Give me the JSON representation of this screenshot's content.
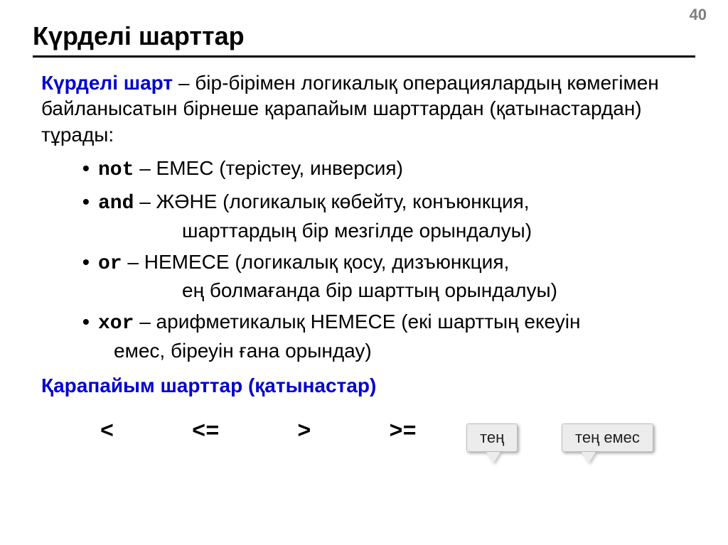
{
  "page_number": "40",
  "title": "Күрделі шарттар",
  "definition": {
    "term": "Күрделі шарт",
    "rest": " – бір-бірімен логикалық операциялардың көмегімен байланысатын бірнеше қарапайым шарттардан (қатынастардан) тұрады:"
  },
  "bullets": [
    {
      "kw": "not",
      "line1": " – ЕМЕС (терістеу, инверсия)",
      "line2": ""
    },
    {
      "kw": "and",
      "line1": " – ЖӘНЕ (логикалық көбейту, конъюнкция,",
      "line2": "шарттардың бір мезгілде орындалуы)"
    },
    {
      "kw": "or",
      "line1": " – НЕМЕСЕ (логикалық қосу, дизъюнкция,",
      "line2": "ең болмағанда бір шарттың орындалуы)"
    },
    {
      "kw": "xor",
      "line1": " – арифметикалық НЕМЕСЕ (екі шарттың екеуін",
      "line2": "емес, біреуін ғана орындау)"
    }
  ],
  "simple_head": "Қарапайым шарттар (қатынастар)",
  "callouts": {
    "eq": "тең",
    "neq": "тең емес"
  },
  "operators": [
    "<",
    "<=",
    ">",
    ">=",
    "=",
    "<>"
  ]
}
